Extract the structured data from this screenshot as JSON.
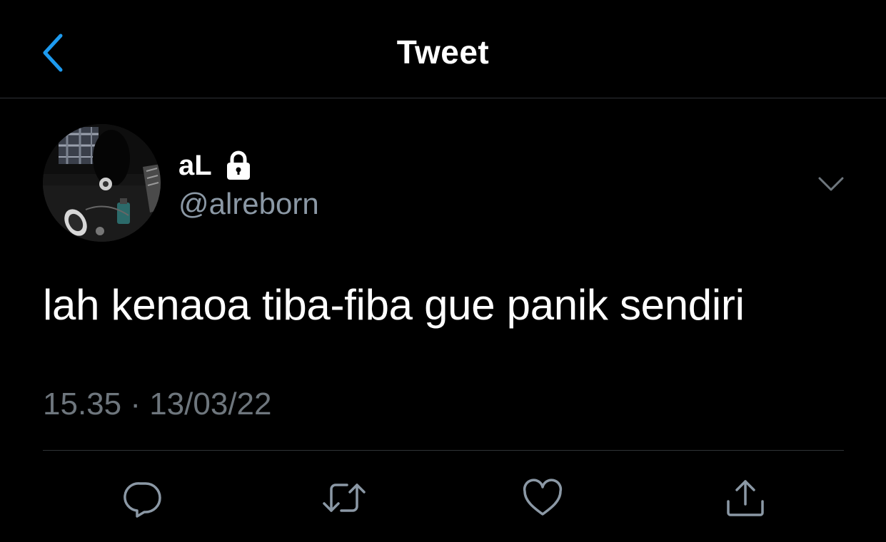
{
  "header": {
    "title": "Tweet",
    "back_icon": "chevron-left-icon"
  },
  "author": {
    "display_name": "aL",
    "username": "@alreborn",
    "protected_icon": "lock-icon"
  },
  "tweet": {
    "text": "lah kenaoa tiba-fiba gue panik sendiri",
    "timestamp": "15.35 · 13/03/22"
  },
  "actions": [
    {
      "icon": "reply-icon"
    },
    {
      "icon": "retweet-icon"
    },
    {
      "icon": "like-icon"
    },
    {
      "icon": "share-icon"
    }
  ],
  "colors": {
    "background": "#000000",
    "accent": "#1d9bf0",
    "secondary_text": "#8b98a5",
    "timestamp_text": "#6e767d",
    "icon_gray": "#8b98a5",
    "divider": "#2f3336"
  }
}
